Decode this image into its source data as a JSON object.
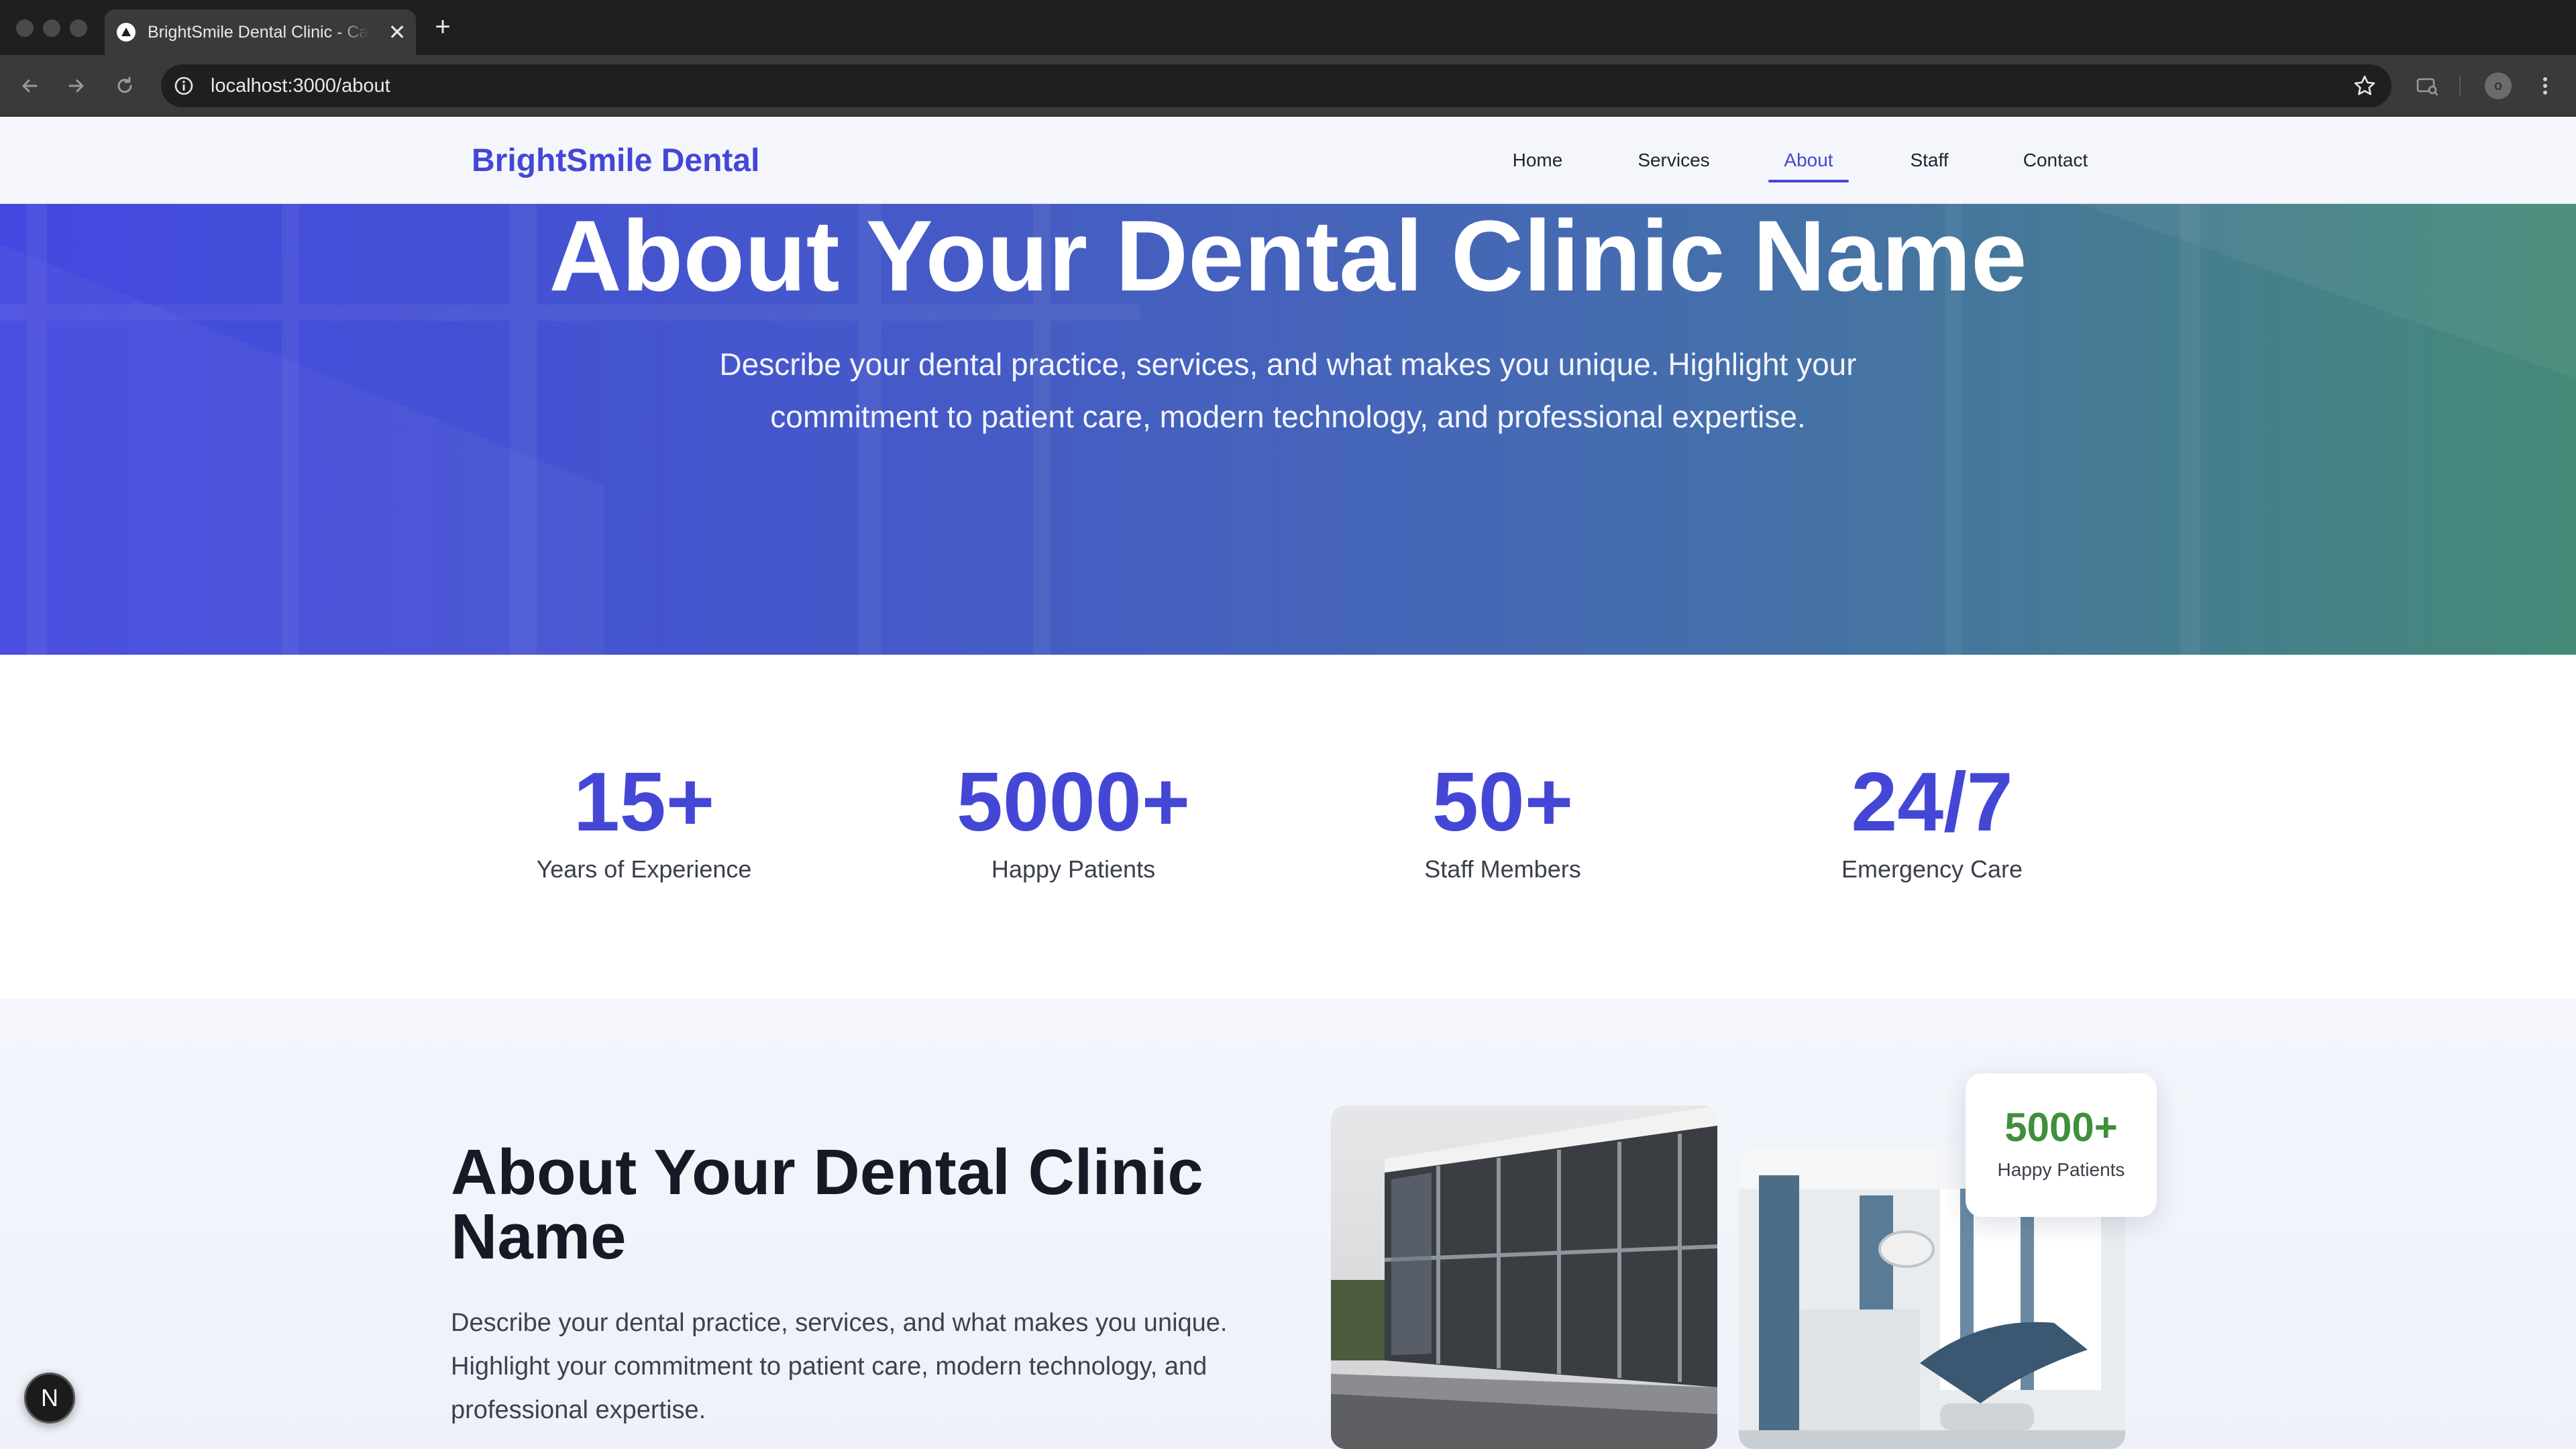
{
  "browser": {
    "tab_title": "BrightSmile Dental Clinic - Ca",
    "tab_close": "✕",
    "new_tab": "+",
    "url": "localhost:3000/about",
    "profile_initial": "o"
  },
  "header": {
    "brand": "BrightSmile Dental",
    "nav": [
      "Home",
      "Services",
      "About",
      "Staff",
      "Contact"
    ],
    "active_nav": "About"
  },
  "hero": {
    "title": "About Your Dental Clinic Name",
    "description": "Describe your dental practice, services, and what makes you unique. Highlight your commitment to patient care, modern technology, and professional expertise."
  },
  "stats": [
    {
      "value": "15+",
      "label": "Years of Experience"
    },
    {
      "value": "5000+",
      "label": "Happy Patients"
    },
    {
      "value": "50+",
      "label": "Staff Members"
    },
    {
      "value": "24/7",
      "label": "Emergency Care"
    }
  ],
  "about": {
    "title": "About Your Dental Clinic Name",
    "description": "Describe your dental practice, services, and what makes you unique. Highlight your commitment to patient care, modern technology, and professional expertise.",
    "badge_value": "5000+",
    "badge_label": "Happy Patients"
  },
  "dev_indicator": "N",
  "colors": {
    "brand": "#4447d6",
    "badge_green": "#3f8f3b",
    "hero_start": "#4448e0",
    "hero_end": "#458a78"
  }
}
